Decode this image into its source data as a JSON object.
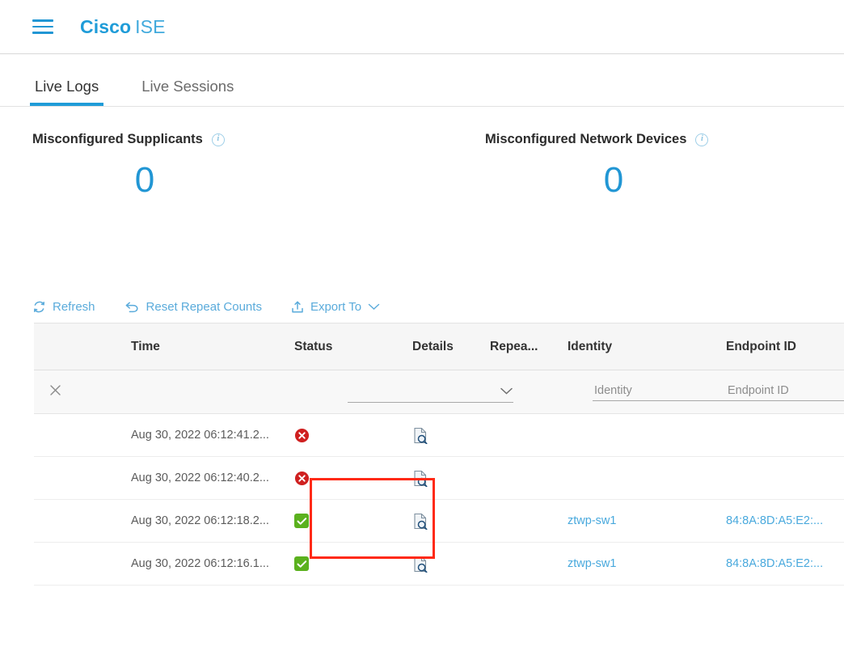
{
  "header": {
    "menu_icon": "hamburger-menu-icon",
    "brand_bold": "Cisco",
    "brand_light": "ISE"
  },
  "tabs": [
    {
      "label": "Live Logs",
      "active": true
    },
    {
      "label": "Live Sessions",
      "active": false
    }
  ],
  "dashlets": [
    {
      "title": "Misconfigured Supplicants",
      "value": "0",
      "info_icon": "info-icon"
    },
    {
      "title": "Misconfigured Network Devices",
      "value": "0",
      "info_icon": "info-icon"
    }
  ],
  "toolbar": [
    {
      "label": "Refresh",
      "icon": "refresh-icon"
    },
    {
      "label": "Reset Repeat Counts",
      "icon": "undo-arrow-icon"
    },
    {
      "label": "Export To",
      "icon": "export-upload-icon",
      "caret": "chevron-down-icon"
    }
  ],
  "table": {
    "columns": [
      "Time",
      "Status",
      "Details",
      "Repea...",
      "Identity",
      "Endpoint ID"
    ],
    "filter_row": {
      "clear_icon": "close-x-icon",
      "status_select_value": "",
      "identity_placeholder": "Identity",
      "endpoint_placeholder": "Endpoint ID",
      "identity_value": "",
      "endpoint_value": ""
    },
    "rows": [
      {
        "time": "Aug 30, 2022 06:12:41.2...",
        "status": "fail",
        "details_icon": "details-report-icon",
        "repeat": "",
        "identity": "",
        "endpoint": ""
      },
      {
        "time": "Aug 30, 2022 06:12:40.2...",
        "status": "fail",
        "details_icon": "details-report-icon",
        "repeat": "",
        "identity": "",
        "endpoint": ""
      },
      {
        "time": "Aug 30, 2022 06:12:18.2...",
        "status": "pass",
        "details_icon": "details-report-icon",
        "repeat": "",
        "identity": "ztwp-sw1",
        "endpoint": "84:8A:8D:A5:E2:..."
      },
      {
        "time": "Aug 30, 2022 06:12:16.1...",
        "status": "pass",
        "details_icon": "details-report-icon",
        "repeat": "",
        "identity": "ztwp-sw1",
        "endpoint": "84:8A:8D:A5:E2:..."
      }
    ]
  },
  "annotation": {
    "type": "red-highlight-rectangle",
    "color": "#ff2a16"
  },
  "colors": {
    "brand_blue": "#1f9cd8",
    "link_blue": "#49a9dd",
    "status_fail_red": "#cf2020",
    "status_pass_green": "#5bb11e",
    "highlight_red": "#ff2a16"
  }
}
